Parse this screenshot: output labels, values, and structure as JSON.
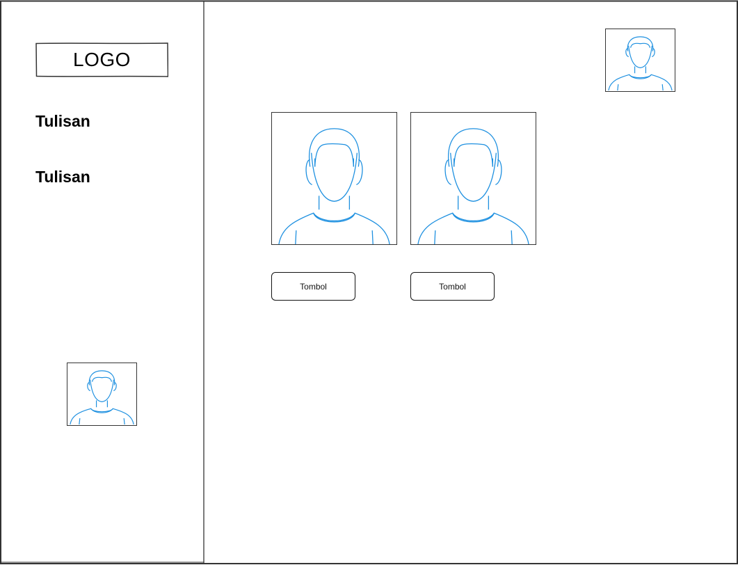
{
  "sidebar": {
    "logo_label": "LOGO",
    "items": [
      {
        "label": "Tulisan"
      },
      {
        "label": "Tulisan"
      }
    ],
    "avatar_icon": "user-avatar-icon"
  },
  "header": {
    "avatar_icon": "user-avatar-icon"
  },
  "main": {
    "cards": [
      {
        "image_icon": "user-avatar-icon",
        "button_label": "Tombol"
      },
      {
        "image_icon": "user-avatar-icon",
        "button_label": "Tombol"
      }
    ]
  },
  "colors": {
    "avatar_stroke": "#1E90E0",
    "border": "#333333",
    "text": "#000000",
    "background": "#FFFFFF"
  }
}
